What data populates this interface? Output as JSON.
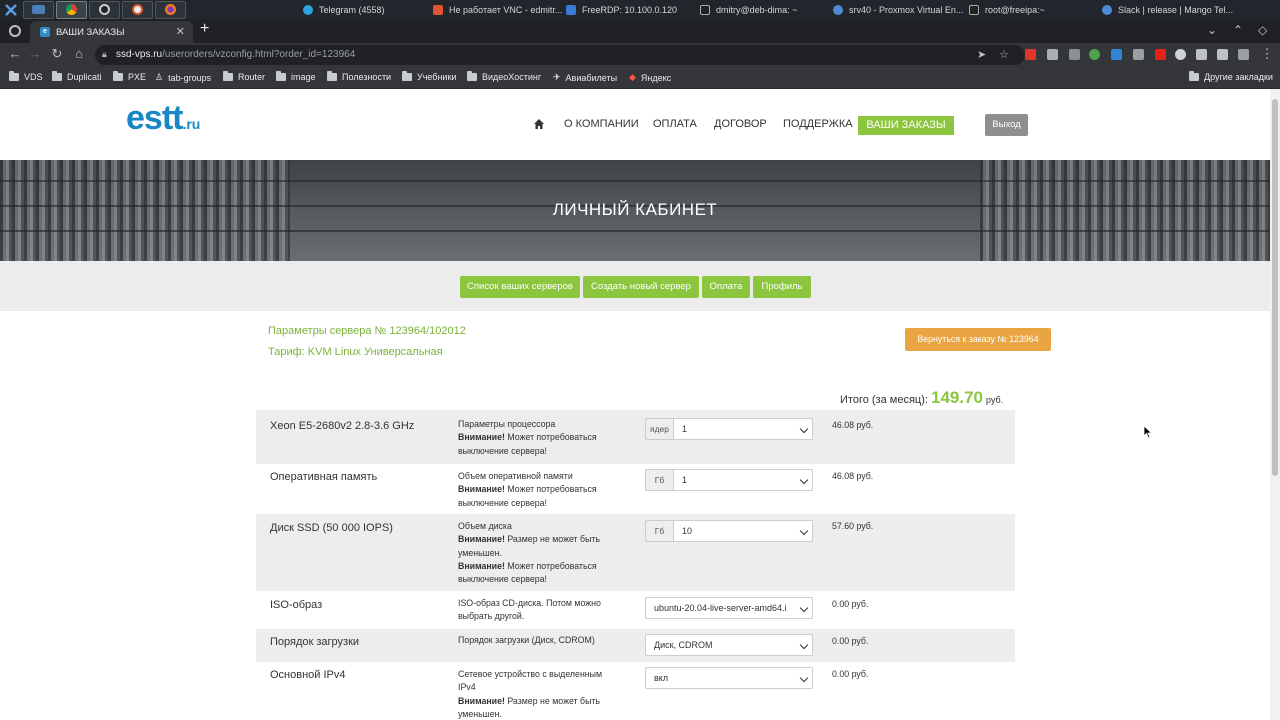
{
  "taskbar": {
    "tasks": [
      {
        "label": "Telegram (4558)",
        "icon": "telegram-icon",
        "color": "#2ca5e0"
      },
      {
        "label": "Не работает VNC - edmitr...",
        "icon": "shield-icon",
        "color": "#e0542f"
      },
      {
        "label": "FreeRDP: 10.100.0.120",
        "icon": "rdp-icon",
        "color": "#3a7bd5"
      },
      {
        "label": "dmitry@deb-dima: ~",
        "icon": "terminal-icon",
        "color": "#8a8a8a"
      },
      {
        "label": "srv40 - Proxmox Virtual En...",
        "icon": "chrome-icon",
        "color": "#4f8bd6"
      },
      {
        "label": "root@freeipa:~",
        "icon": "terminal-icon",
        "color": "#8a8a8a"
      },
      {
        "label": "Slack | release | Mango Tel...",
        "icon": "chrome-icon",
        "color": "#4f8bd6"
      }
    ]
  },
  "browser": {
    "tab_title": "ВАШИ ЗАКАЗЫ",
    "url_host": "ssd-vps.ru",
    "url_path": "/userorders/vzconfig.html?order_id=123964",
    "bookmarks": [
      "VDS",
      "Duplicati",
      "PXE",
      "tab-groups",
      "Router",
      "image",
      "Полезности",
      "Учебники",
      "ВидеоХостинг",
      "Авиабилеты",
      "Яндекс"
    ],
    "other_bookmarks": "Другие закладки"
  },
  "site": {
    "logo_main": "estt",
    "logo_suffix": ".ru",
    "menu": {
      "about": "О КОМПАНИИ",
      "payment": "ОПЛАТА",
      "contract": "ДОГОВОР",
      "support": "ПОДДЕРЖКА",
      "orders": "ВАШИ ЗАКАЗЫ"
    },
    "logout": "Выход",
    "banner_title": "ЛИЧНЫЙ КАБИНЕТ",
    "subnav": {
      "servers": "Список ваших серверов",
      "create": "Создать новый сервер",
      "payment": "Оплата",
      "profile": "Профиль"
    },
    "colors": {
      "accent": "#8cc63f",
      "back": "#e9a541",
      "logo": "#1a86c3"
    }
  },
  "config": {
    "params_title": "Параметры сервера № 123964/102012",
    "tariff": "Тариф: KVM Linux Универсальная",
    "back_button": "Вернуться к заказу № 123964",
    "total_label": "Итого (за месяц):",
    "total_value": "149.70",
    "total_currency": "руб.",
    "rows": [
      {
        "name": "Xeon E5-2680v2 2.8-3.6 GHz",
        "desc": "Параметры процессора",
        "warn": "Внимание!",
        "warn_text": "Может потребоваться выключение сервера!",
        "unit": "ядер",
        "value": "1",
        "price": "46.08 руб."
      },
      {
        "name": "Оперативная память",
        "desc": "Объем оперативной памяти",
        "warn": "Внимание!",
        "warn_text": "Может потребоваться выключение сервера!",
        "unit": "Гб",
        "value": "1",
        "price": "46.08 руб."
      },
      {
        "name": "Диск SSD (50 000 IOPS)",
        "desc": "Объем диска",
        "warn": "Внимание!",
        "warn_text": "Размер не может быть уменьшен.",
        "warn2": "Внимание!",
        "warn2_text": "Может потребоваться выключение сервера!",
        "unit": "Гб",
        "value": "10",
        "price": "57.60 руб."
      },
      {
        "name": "ISO-образ",
        "desc": "ISO-образ CD-диска. Потом можно выбрать другой.",
        "value": "ubuntu-20.04-live-server-amd64.i",
        "price": "0.00 руб."
      },
      {
        "name": "Порядок загрузки",
        "desc": "Порядок загрузки (Диск, CDROM)",
        "value": "Диск, CDROM",
        "price": "0.00 руб."
      },
      {
        "name": "Основной IPv4",
        "desc": "Сетевое устройство с выделенным IPv4",
        "warn": "Внимание!",
        "warn_text": "Размер не может быть уменьшен.",
        "value": "вкл",
        "price": "0.00 руб."
      }
    ]
  }
}
